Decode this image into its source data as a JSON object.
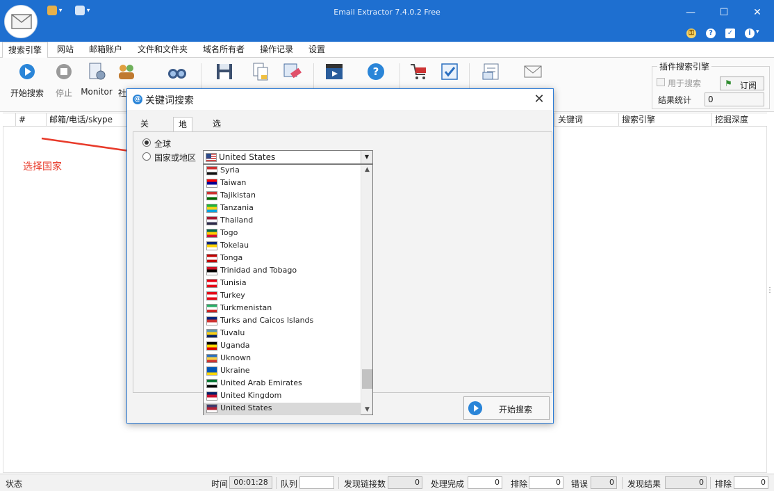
{
  "window": {
    "title": "Email Extractor 7.4.0.2 Free"
  },
  "menu": {
    "tabs": [
      "搜索引擎",
      "网站",
      "邮箱账户",
      "文件和文件夹",
      "域名所有者",
      "操作记录",
      "设置"
    ]
  },
  "ribbon": {
    "start_search": "开始搜索",
    "stop": "停止",
    "monitor": "Monitor",
    "social_partial": "社"
  },
  "plugin": {
    "group_title": "插件搜索引擎",
    "use_for_search": "用于搜索",
    "subscribe": "订阅",
    "stats_label": "结果统计",
    "stats_value": "0"
  },
  "grid": {
    "columns_left": [
      "#",
      "邮箱/电话/skype"
    ],
    "columns_right": [
      "关键词",
      "搜索引擎",
      "挖掘深度"
    ]
  },
  "annotation": {
    "text": "选择国家",
    "color": "#e83a2a"
  },
  "dialog": {
    "title": "关键词搜索",
    "tabs": [
      "关键词",
      "地区",
      "选项"
    ],
    "active_tab": "地区",
    "radio_global": "全球",
    "radio_country": "国家或地区",
    "selected_option": "global",
    "combo_value": "United States",
    "countries": [
      "Syria",
      "Taiwan",
      "Tajikistan",
      "Tanzania",
      "Thailand",
      "Togo",
      "Tokelau",
      "Tonga",
      "Trinidad and Tobago",
      "Tunisia",
      "Turkey",
      "Turkmenistan",
      "Turks and Caicos Islands",
      "Tuvalu",
      "Uganda",
      "Uknown",
      "Ukraine",
      "United Arab Emirates",
      "United Kingdom",
      "United States"
    ],
    "highlighted_country": "United States",
    "start_button": "开始搜索"
  },
  "status": {
    "state_label": "状态",
    "time_label": "时间",
    "time_value": "00:01:28",
    "queue_label": "队列",
    "queue_value": "",
    "links_label": "发现链接数",
    "links_value": "0",
    "done_label": "处理完成",
    "done_value": "0",
    "exclude_label": "排除",
    "exclude_value": "0",
    "error_label": "错误",
    "error_value": "0",
    "found_label": "发现结果",
    "found_value": "0",
    "exclude2_label": "排除",
    "exclude2_value": "0"
  }
}
